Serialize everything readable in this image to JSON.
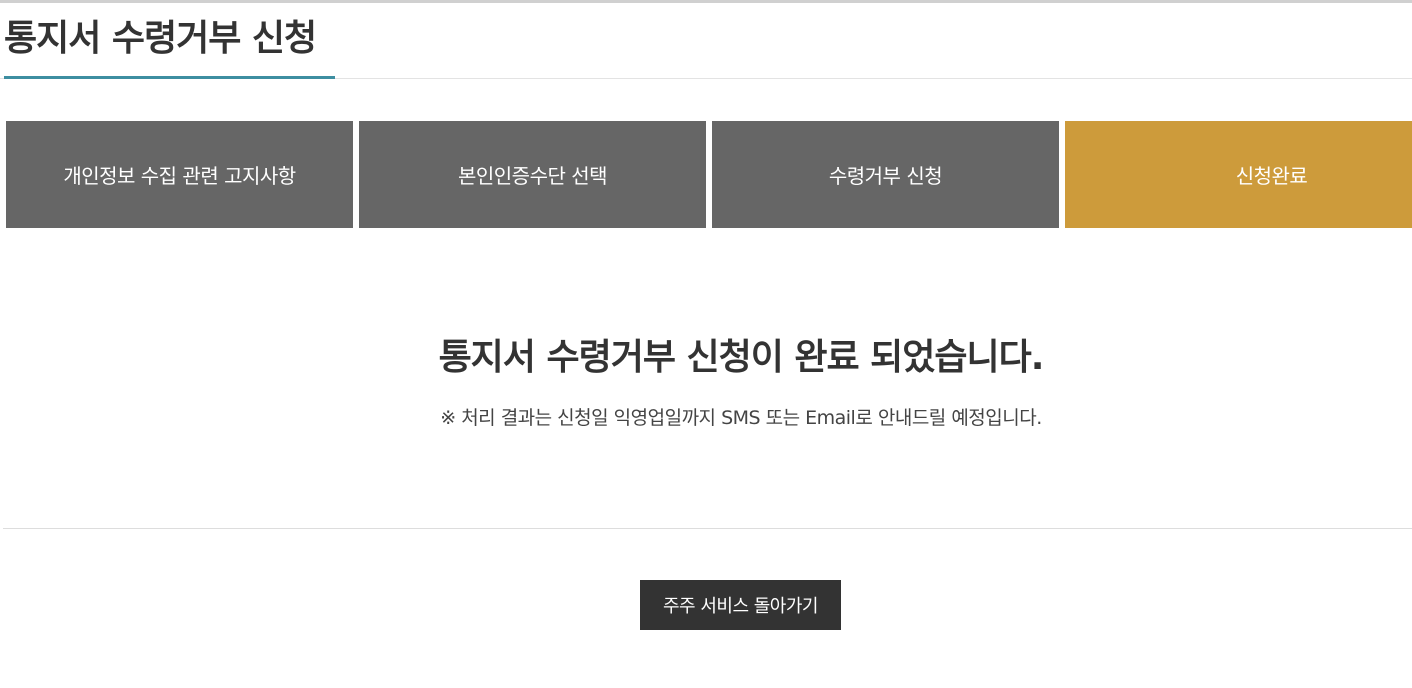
{
  "page": {
    "title": "통지서 수령거부 신청"
  },
  "steps": [
    {
      "label": "개인정보 수집 관련 고지사항",
      "active": false
    },
    {
      "label": "본인인증수단 선택",
      "active": false
    },
    {
      "label": "수령거부 신청",
      "active": false
    },
    {
      "label": "신청완료",
      "active": true
    }
  ],
  "colors": {
    "step_inactive": "#666666",
    "step_active": "#cd9b3b",
    "title_underline": "#3d8ea1",
    "button_bg": "#333333"
  },
  "completion": {
    "heading": "통지서 수령거부 신청이 완료 되었습니다.",
    "note": "※ 처리 결과는 신청일 익영업일까지 SMS 또는 Email로 안내드릴 예정입니다."
  },
  "actions": {
    "back_button_label": "주주 서비스 돌아가기"
  }
}
